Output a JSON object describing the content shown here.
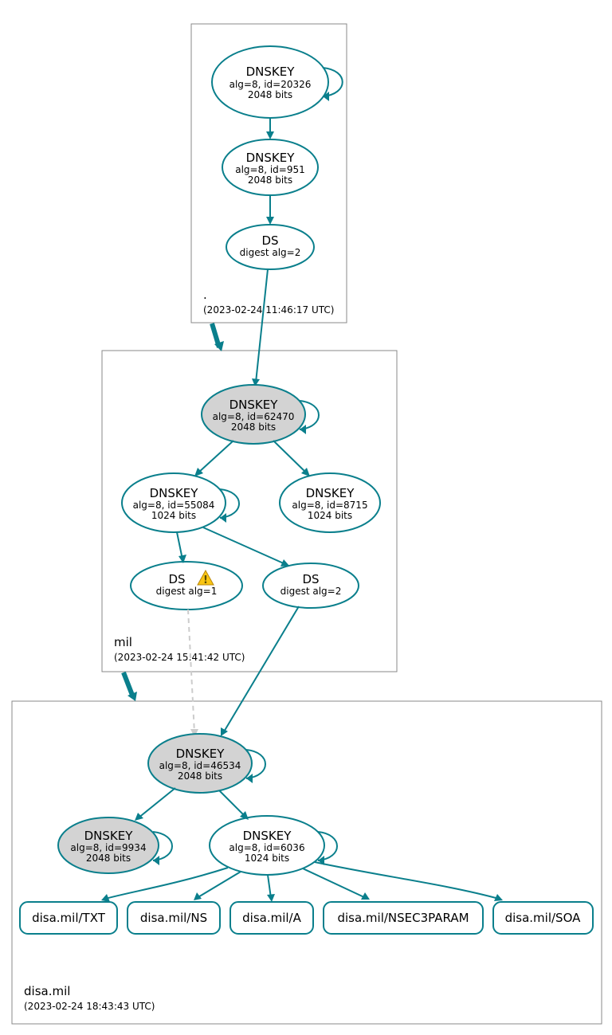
{
  "zones": {
    "root": {
      "label": ".",
      "timestamp": "(2023-02-24 11:46:17 UTC)"
    },
    "mil": {
      "label": "mil",
      "timestamp": "(2023-02-24 15:41:42 UTC)"
    },
    "disa": {
      "label": "disa.mil",
      "timestamp": "(2023-02-24 18:43:43 UTC)"
    }
  },
  "nodes": {
    "root_ksk": {
      "title": "DNSKEY",
      "l1": "alg=8, id=20326",
      "l2": "2048 bits"
    },
    "root_zsk": {
      "title": "DNSKEY",
      "l1": "alg=8, id=951",
      "l2": "2048 bits"
    },
    "root_ds": {
      "title": "DS",
      "l1": "digest alg=2"
    },
    "mil_ksk": {
      "title": "DNSKEY",
      "l1": "alg=8, id=62470",
      "l2": "2048 bits"
    },
    "mil_zsk1": {
      "title": "DNSKEY",
      "l1": "alg=8, id=55084",
      "l2": "1024 bits"
    },
    "mil_zsk2": {
      "title": "DNSKEY",
      "l1": "alg=8, id=8715",
      "l2": "1024 bits"
    },
    "mil_ds1": {
      "title": "DS",
      "l1": "digest alg=1",
      "warn": true
    },
    "mil_ds2": {
      "title": "DS",
      "l1": "digest alg=2"
    },
    "disa_ksk": {
      "title": "DNSKEY",
      "l1": "alg=8, id=46534",
      "l2": "2048 bits"
    },
    "disa_k2": {
      "title": "DNSKEY",
      "l1": "alg=8, id=9934",
      "l2": "2048 bits"
    },
    "disa_zsk": {
      "title": "DNSKEY",
      "l1": "alg=8, id=6036",
      "l2": "1024 bits"
    },
    "rr_txt": {
      "label": "disa.mil/TXT"
    },
    "rr_ns": {
      "label": "disa.mil/NS"
    },
    "rr_a": {
      "label": "disa.mil/A"
    },
    "rr_nsec3": {
      "label": "disa.mil/NSEC3PARAM"
    },
    "rr_soa": {
      "label": "disa.mil/SOA"
    }
  }
}
